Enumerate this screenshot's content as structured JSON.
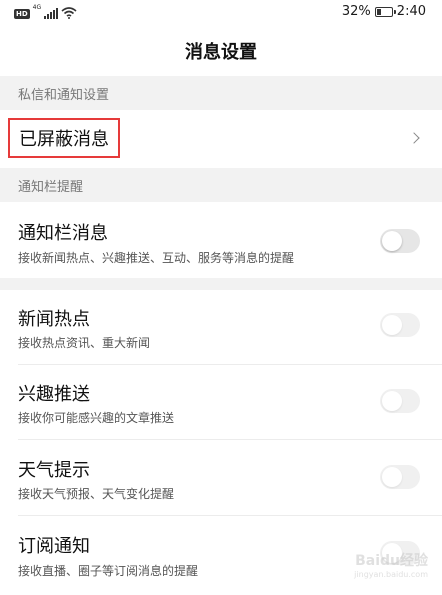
{
  "status_bar": {
    "hd_badge": "HD",
    "network_type": "4G",
    "battery_percent": "32%",
    "battery_level": 0.32,
    "time": "2:40",
    "icons": [
      "signal-icon",
      "wifi-icon",
      "battery-icon"
    ]
  },
  "header": {
    "title": "消息设置"
  },
  "sections": {
    "private_header": "私信和通知设置",
    "notification_header": "通知栏提醒"
  },
  "blocked_row": {
    "label": "已屏蔽消息",
    "icon": "chevron-right-icon"
  },
  "notification_items": [
    {
      "title": "通知栏消息",
      "subtitle": "接收新闻热点、兴趣推送、互动、服务等消息的提醒",
      "enabled": false
    },
    {
      "title": "新闻热点",
      "subtitle": "接收热点资讯、重大新闻",
      "enabled": false
    },
    {
      "title": "兴趣推送",
      "subtitle": "接收你可能感兴趣的文章推送",
      "enabled": false
    },
    {
      "title": "天气提示",
      "subtitle": "接收天气预报、天气变化提醒",
      "enabled": false
    },
    {
      "title": "订阅通知",
      "subtitle": "接收直播、圈子等订阅消息的提醒",
      "enabled": false
    }
  ],
  "watermark": {
    "brand": "Baidu经验",
    "url": "jingyan.baidu.com"
  },
  "colors": {
    "highlight_border": "#e63a3a",
    "section_bg": "#f2f2f2",
    "toggle_off": "#e6e6e6"
  }
}
